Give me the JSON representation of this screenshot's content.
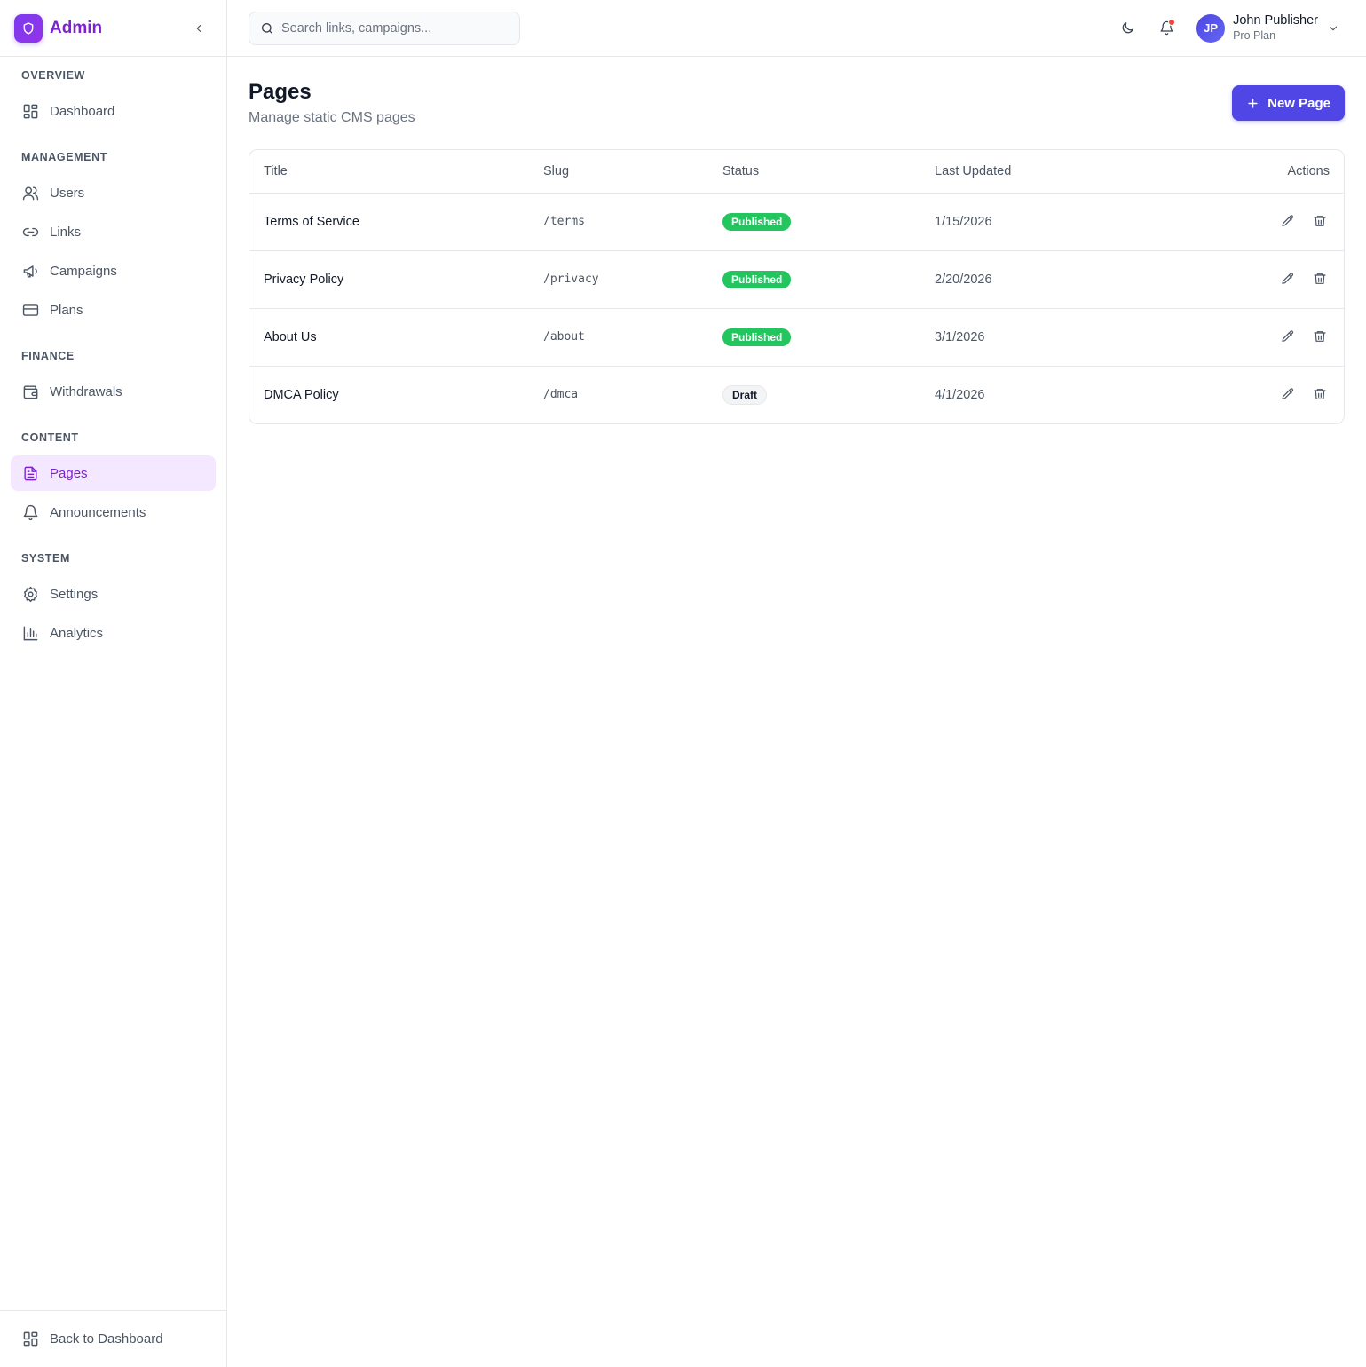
{
  "brand": {
    "name": "Admin",
    "accent": "#7e22ce"
  },
  "sidebar": {
    "sections": [
      {
        "label": "OVERVIEW",
        "items": [
          {
            "label": "Dashboard",
            "icon": "layout-dashboard-icon"
          }
        ]
      },
      {
        "label": "MANAGEMENT",
        "items": [
          {
            "label": "Users",
            "icon": "users-icon"
          },
          {
            "label": "Links",
            "icon": "link-icon"
          },
          {
            "label": "Campaigns",
            "icon": "megaphone-icon"
          },
          {
            "label": "Plans",
            "icon": "credit-card-icon"
          }
        ]
      },
      {
        "label": "FINANCE",
        "items": [
          {
            "label": "Withdrawals",
            "icon": "wallet-icon"
          }
        ]
      },
      {
        "label": "CONTENT",
        "items": [
          {
            "label": "Pages",
            "icon": "file-text-icon",
            "active": true
          },
          {
            "label": "Announcements",
            "icon": "bell-icon"
          }
        ]
      },
      {
        "label": "SYSTEM",
        "items": [
          {
            "label": "Settings",
            "icon": "gear-icon"
          },
          {
            "label": "Analytics",
            "icon": "bar-chart-icon"
          }
        ]
      }
    ],
    "footer_label": "Back to Dashboard"
  },
  "topbar": {
    "search_placeholder": "Search links, campaigns...",
    "user": {
      "initials": "JP",
      "name": "John Publisher",
      "plan": "Pro Plan"
    },
    "has_notification": true
  },
  "page": {
    "title": "Pages",
    "subtitle": "Manage static CMS pages",
    "new_button_label": "New Page"
  },
  "table": {
    "columns": [
      "Title",
      "Slug",
      "Status",
      "Last Updated",
      "Actions"
    ],
    "rows": [
      {
        "title": "Terms of Service",
        "slug": "/terms",
        "status": "Published",
        "updated": "1/15/2026"
      },
      {
        "title": "Privacy Policy",
        "slug": "/privacy",
        "status": "Published",
        "updated": "2/20/2026"
      },
      {
        "title": "About Us",
        "slug": "/about",
        "status": "Published",
        "updated": "3/1/2026"
      },
      {
        "title": "DMCA Policy",
        "slug": "/dmca",
        "status": "Draft",
        "updated": "4/1/2026"
      }
    ]
  },
  "colors": {
    "primary_button": "#4f46e5",
    "published": "#22c55e",
    "notification_dot": "#ef4444"
  }
}
